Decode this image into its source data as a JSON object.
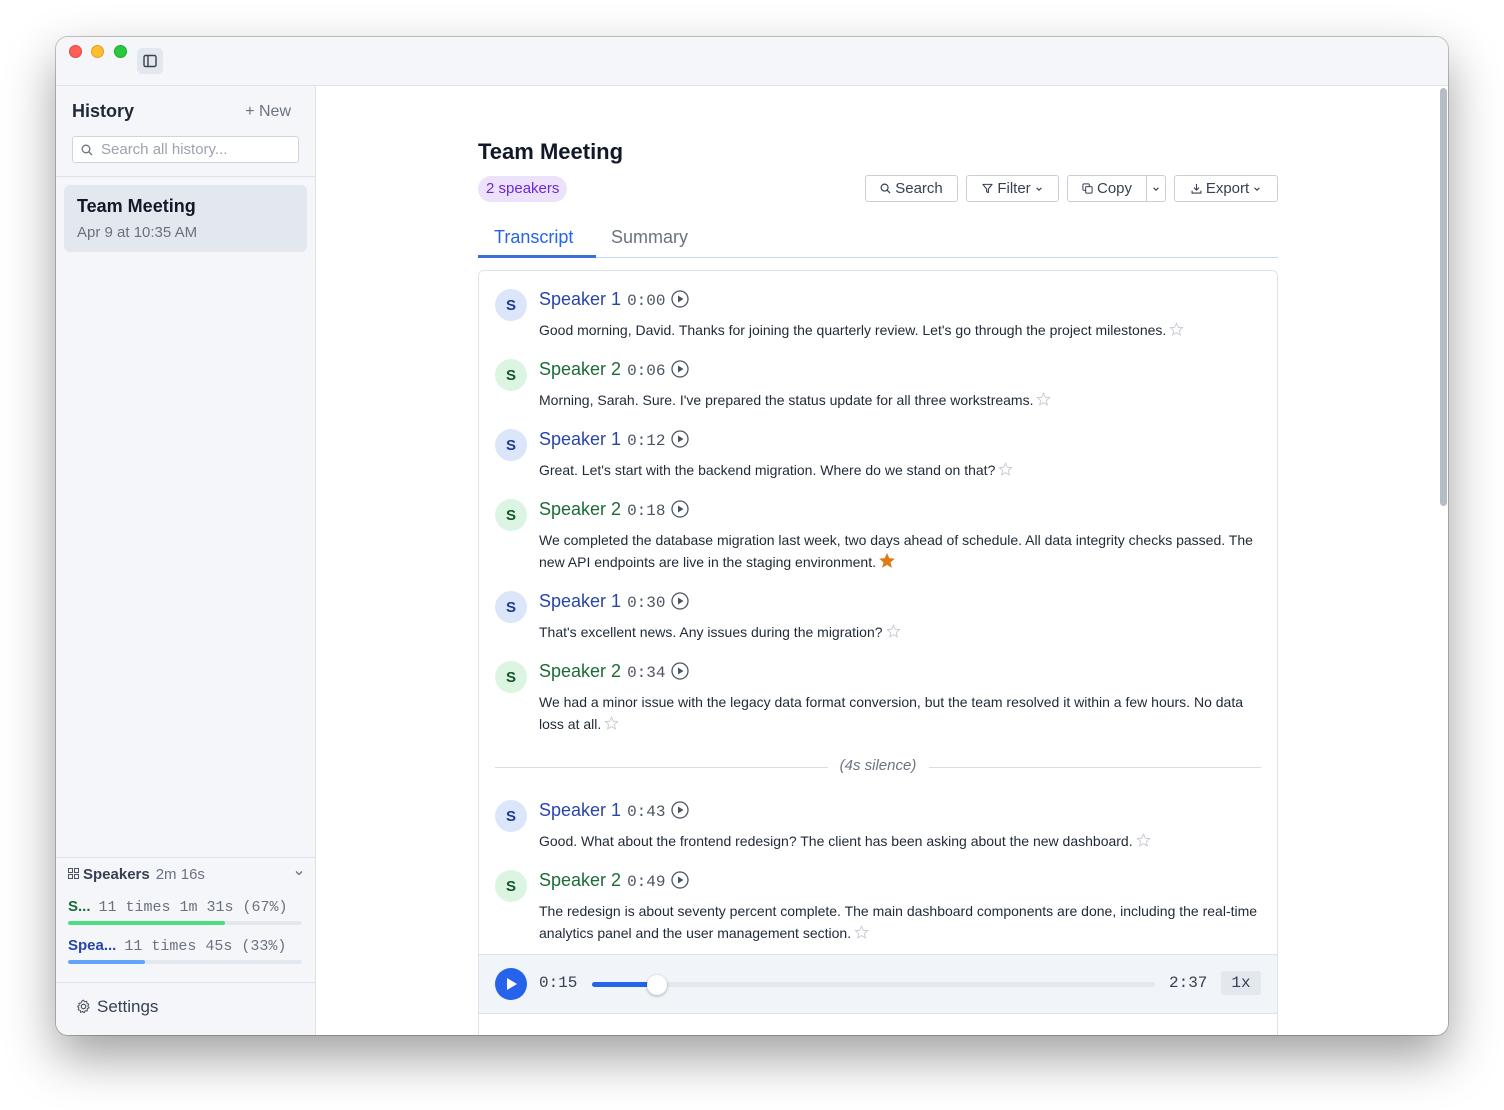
{
  "sidebar": {
    "title": "History",
    "new_label": "New",
    "search_placeholder": "Search all history...",
    "items": [
      {
        "title": "Team Meeting",
        "date": "Apr 9 at 10:35 AM"
      }
    ],
    "speakers": {
      "label": "Speakers",
      "total_duration": "2m 16s",
      "rows": [
        {
          "name": "S...",
          "stats": "11 times 1m 31s (67%)",
          "share": 0.67,
          "color": "#4ade80",
          "name_color": "#1b6b37"
        },
        {
          "name": "Spea...",
          "stats": "11 times 45s (33%)",
          "share": 0.33,
          "color": "#60a5fa",
          "name_color": "#2945a8"
        }
      ]
    },
    "settings_label": "Settings"
  },
  "main": {
    "title": "Team Meeting",
    "speakers_badge": "2 speakers",
    "toolbar": {
      "search_label": "Search",
      "filter_label": "Filter",
      "copy_label": "Copy",
      "export_label": "Export"
    },
    "tabs": [
      {
        "label": "Transcript",
        "active": true
      },
      {
        "label": "Summary",
        "active": false
      }
    ],
    "transcript": [
      {
        "initial": "S",
        "speaker": "Speaker 1",
        "time": "0:00",
        "text": "Good morning, David. Thanks for joining the quarterly review. Let's go through the project milestones.",
        "starred": false
      },
      {
        "initial": "S",
        "speaker": "Speaker 2",
        "time": "0:06",
        "text": "Morning, Sarah. Sure. I've prepared the status update for all three workstreams.",
        "starred": false
      },
      {
        "initial": "S",
        "speaker": "Speaker 1",
        "time": "0:12",
        "text": "Great. Let's start with the backend migration. Where do we stand on that?",
        "starred": false
      },
      {
        "initial": "S",
        "speaker": "Speaker 2",
        "time": "0:18",
        "text": "We completed the database migration last week, two days ahead of schedule. All data integrity checks passed. The new API endpoints are live in the staging environment.",
        "starred": true
      },
      {
        "initial": "S",
        "speaker": "Speaker 1",
        "time": "0:30",
        "text": "That's excellent news. Any issues during the migration?",
        "starred": false
      },
      {
        "initial": "S",
        "speaker": "Speaker 2",
        "time": "0:34",
        "text": "We had a minor issue with the legacy data format conversion, but the team resolved it within a few hours. No data loss at all.",
        "starred": false
      },
      {
        "initial": "S",
        "speaker": "Speaker 1",
        "time": "0:43",
        "text": "Good. What about the frontend redesign? The client has been asking about the new dashboard.",
        "starred": false
      },
      {
        "initial": "S",
        "speaker": "Speaker 2",
        "time": "0:49",
        "text": "The redesign is about seventy percent complete. The main dashboard components are done, including the real-time analytics panel and the user management section.",
        "starred": false
      }
    ],
    "silence_label": "(4s silence)",
    "player": {
      "current": "0:15",
      "total": "2:37",
      "progress": 0.115,
      "speed": "1x"
    }
  }
}
